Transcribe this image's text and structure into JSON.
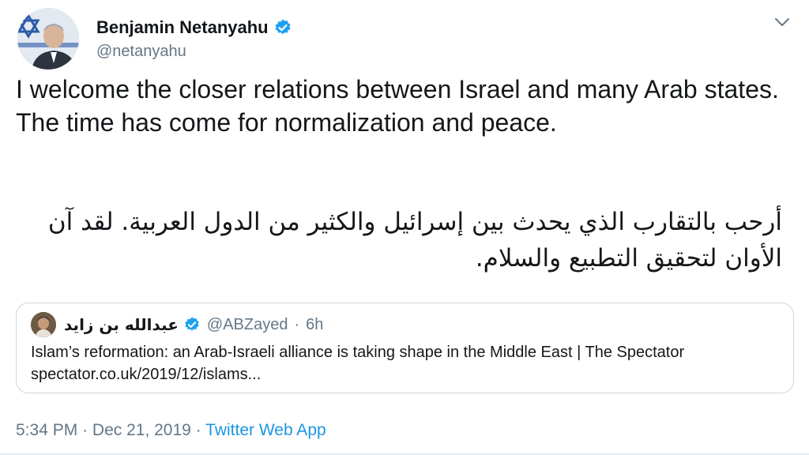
{
  "author": {
    "display_name": "Benjamin Netanyahu",
    "handle": "@netanyahu",
    "verified_icon": "verified-badge-icon",
    "accent": "#1da1f2"
  },
  "tweet": {
    "text_en": "I welcome the closer relations between Israel and many Arab states. The time has come for normalization and peace.",
    "text_ar": "أرحب بالتقارب الذي يحدث بين إسرائيل والكثير من الدول العربية. لقد آن الأوان لتحقيق التطبيع والسلام."
  },
  "quoted": {
    "display_name": "عبدالله بن زايد",
    "handle": "@ABZayed",
    "separator": "·",
    "time": "6h",
    "text": "Islam’s reformation: an Arab-Israeli alliance is taking shape in the Middle East | The Spectator spectator.co.uk/2019/12/islams..."
  },
  "footer": {
    "time": "5:34 PM",
    "separator1": "·",
    "date": "Dec 21, 2019",
    "separator2": "·",
    "source": "Twitter Web App"
  },
  "colors": {
    "text": "#14171a",
    "muted": "#657786",
    "link": "#1b95e0",
    "border": "#ccd6dd"
  }
}
